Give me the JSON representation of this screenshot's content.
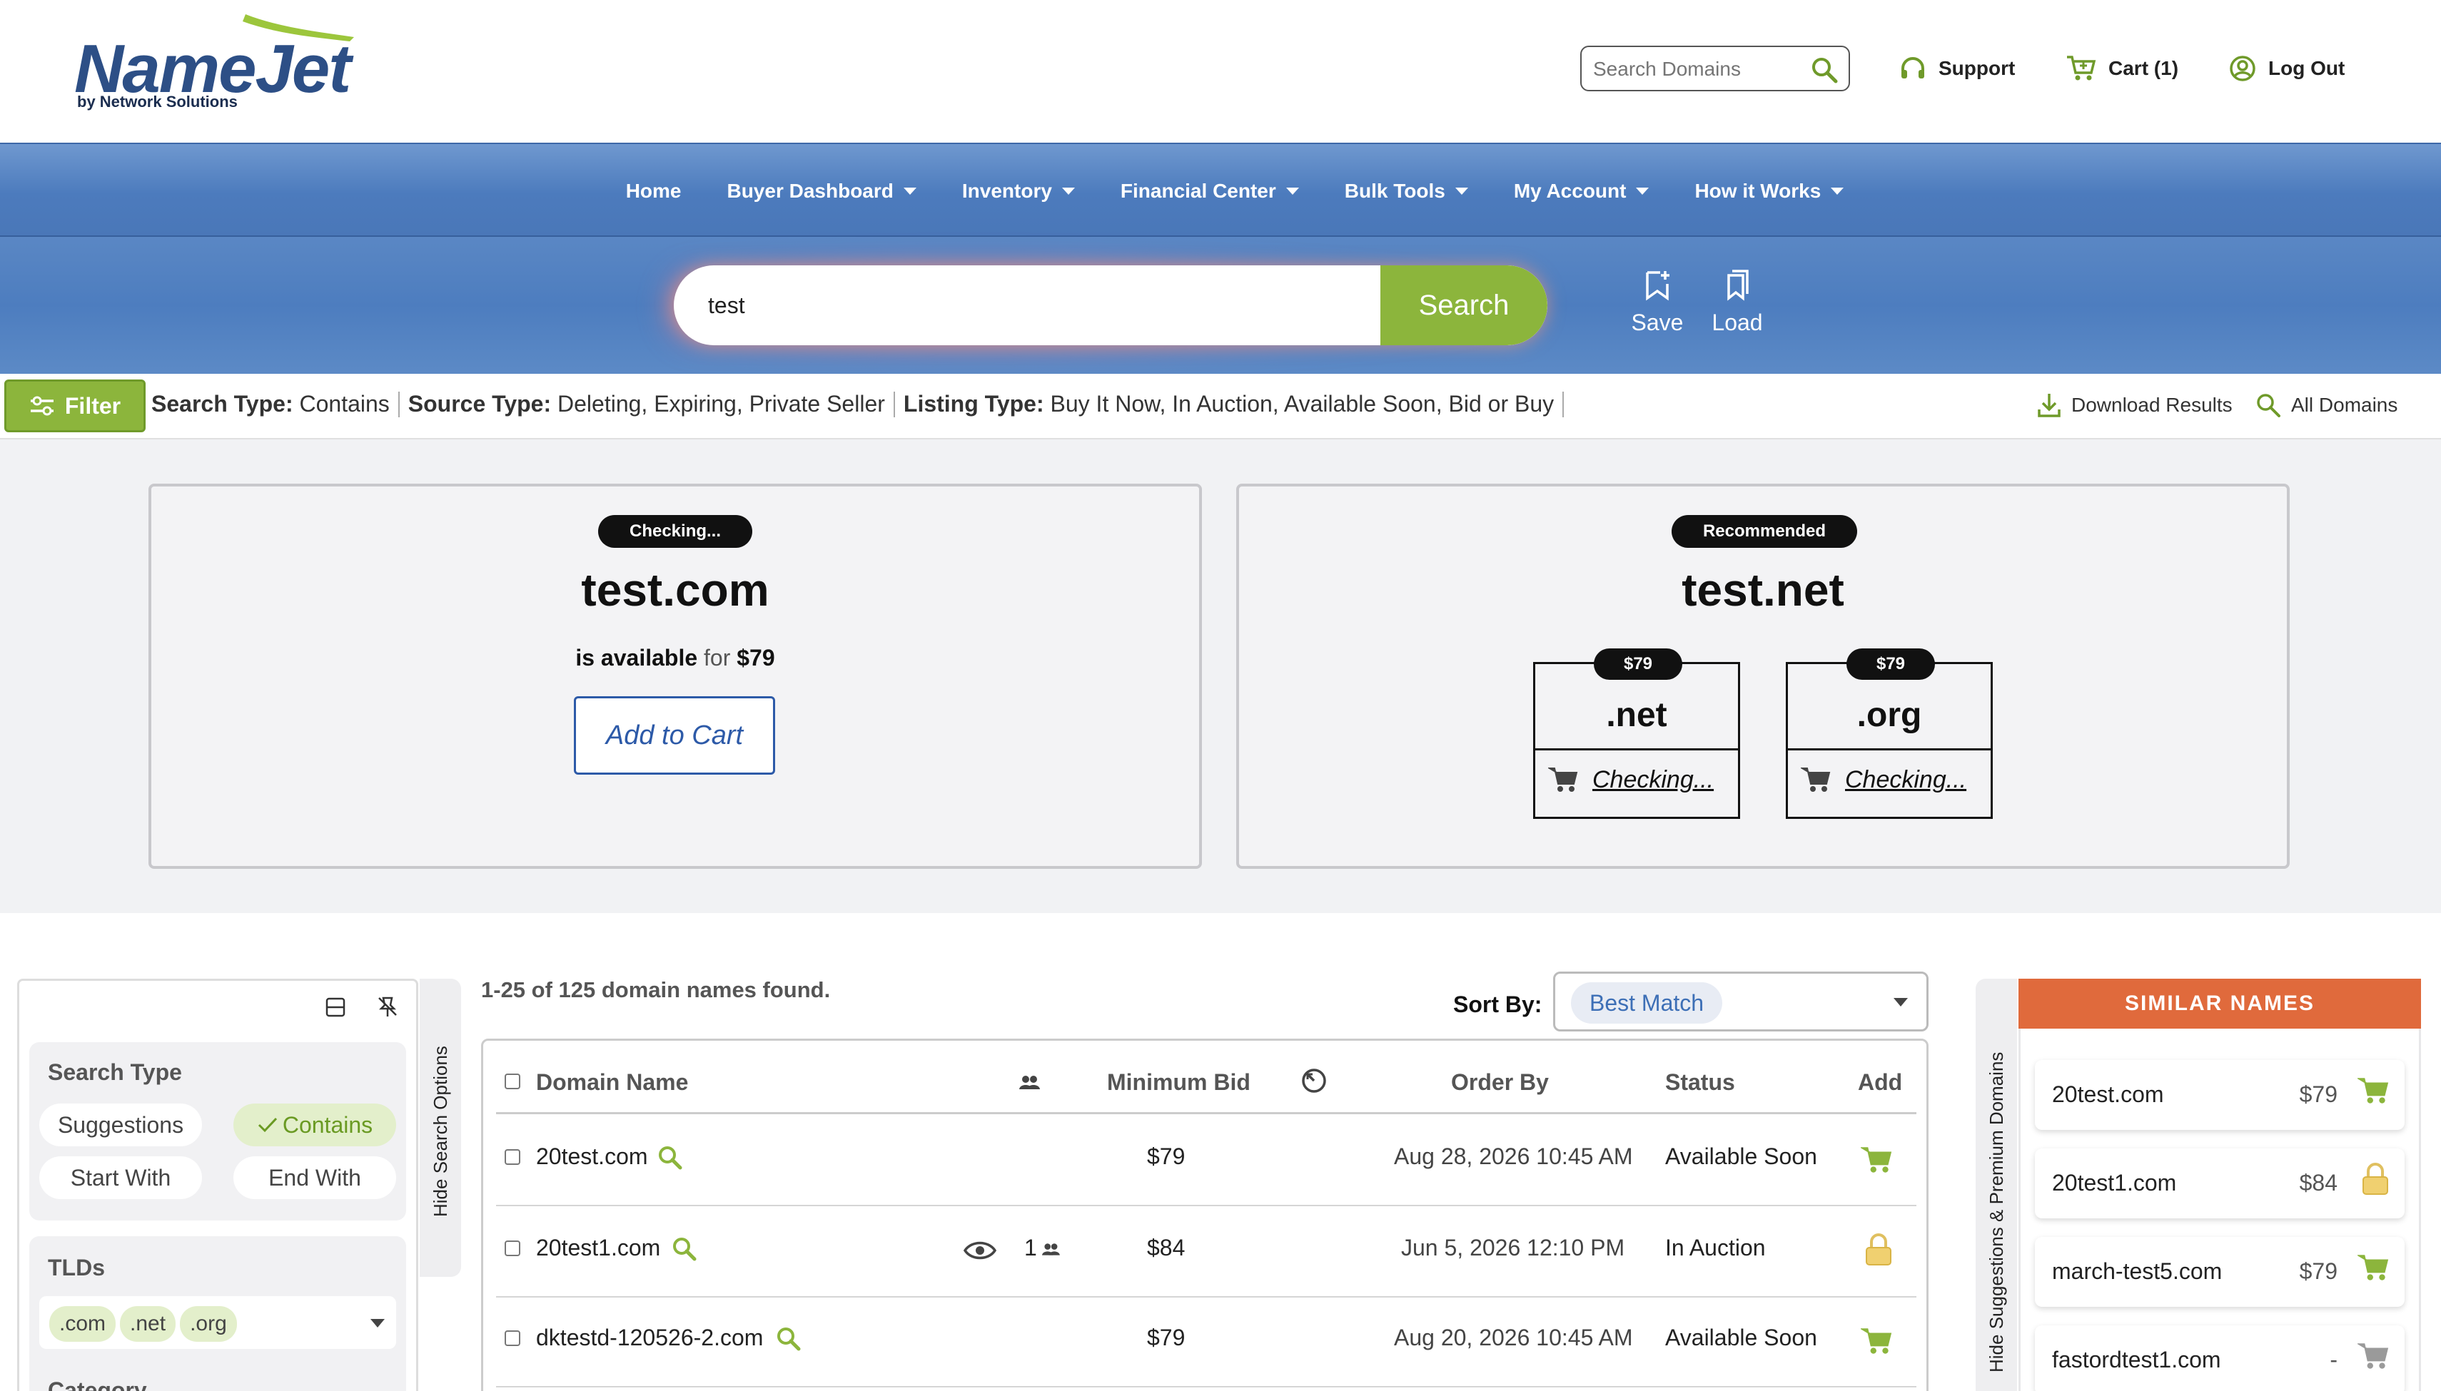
{
  "brand": {
    "name": "NameJet",
    "tagline": "by Network Solutions"
  },
  "header": {
    "search_placeholder": "Search Domains",
    "support_label": "Support",
    "cart_label": "Cart (1)",
    "logout_label": "Log Out"
  },
  "nav": {
    "items": [
      {
        "label": "Home"
      },
      {
        "label": "Buyer Dashboard"
      },
      {
        "label": "Inventory"
      },
      {
        "label": "Financial Center"
      },
      {
        "label": "Bulk Tools"
      },
      {
        "label": "My Account"
      },
      {
        "label": "How it Works"
      }
    ]
  },
  "search": {
    "query": "test",
    "button_label": "Search",
    "save_label": "Save",
    "load_label": "Load"
  },
  "filter": {
    "button_label": "Filter",
    "search_type_label": "Search Type:",
    "search_type_value": "Contains",
    "source_type_label": "Source Type:",
    "source_type_value": "Deleting, Expiring, Private Seller",
    "listing_type_label": "Listing Type:",
    "listing_type_value": "Buy It Now, In Auction, Available Soon, Bid or Buy",
    "download_label": "Download Results",
    "all_domains_label": "All Domains"
  },
  "availability": {
    "primary": {
      "badge": "Checking...",
      "domain": "test.com",
      "status_text": "is available",
      "for_text": "for",
      "price": "$79",
      "add_to_cart_label": "Add to Cart"
    },
    "recommended": {
      "badge": "Recommended",
      "domain": "test.net",
      "tlds": [
        {
          "price": "$79",
          "tld": ".net",
          "status": "Checking..."
        },
        {
          "price": "$79",
          "tld": ".org",
          "status": "Checking..."
        }
      ]
    }
  },
  "sidebar": {
    "hide_search_options_label": "Hide Search Options",
    "search_type_title": "Search Type",
    "search_type_options": [
      "Suggestions",
      "Contains",
      "Start With",
      "End With"
    ],
    "tlds_title": "TLDs",
    "tlds_selected": [
      ".com",
      ".net",
      ".org"
    ],
    "category_title": "Category"
  },
  "results": {
    "count_text": "1-25 of 125 domain names found.",
    "sort_by_label": "Sort By:",
    "sort_value": "Best Match",
    "columns": {
      "domain": "Domain Name",
      "min_bid": "Minimum Bid",
      "order_by": "Order By",
      "status": "Status",
      "add": "Add"
    },
    "rows": [
      {
        "domain": "20test.com",
        "watchers": "",
        "bidders": "",
        "min_bid": "$79",
        "order_by": "Aug 28, 2026 10:45 AM",
        "status": "Available Soon",
        "action_icon": "cart-icon"
      },
      {
        "domain": "20test1.com",
        "watchers": "",
        "bidders": "1",
        "min_bid": "$84",
        "order_by": "Jun 5, 2026 12:10 PM",
        "status": "In Auction",
        "action_icon": "lock-icon"
      },
      {
        "domain": "dktestd-120526-2.com",
        "watchers": "",
        "bidders": "",
        "min_bid": "$79",
        "order_by": "Aug 20, 2026 10:45 AM",
        "status": "Available Soon",
        "action_icon": "cart-icon"
      }
    ]
  },
  "similar": {
    "title": "SIMILAR NAMES",
    "hide_label": "Hide Suggestions & Premium Domains",
    "items": [
      {
        "name": "20test.com",
        "price": "$79",
        "icon": "cart-icon"
      },
      {
        "name": "20test1.com",
        "price": "$84",
        "icon": "lock-icon"
      },
      {
        "name": "march-test5.com",
        "price": "$79",
        "icon": "cart-icon"
      },
      {
        "name": "fastordtest1.com",
        "price": "-",
        "icon": "cart-icon"
      }
    ]
  },
  "colors": {
    "brand_blue": "#2d4f86",
    "nav_blue": "#4c7bbd",
    "accent_green": "#8cb53c",
    "similar_orange": "#e06a3c",
    "link_blue": "#2d5aa8"
  }
}
